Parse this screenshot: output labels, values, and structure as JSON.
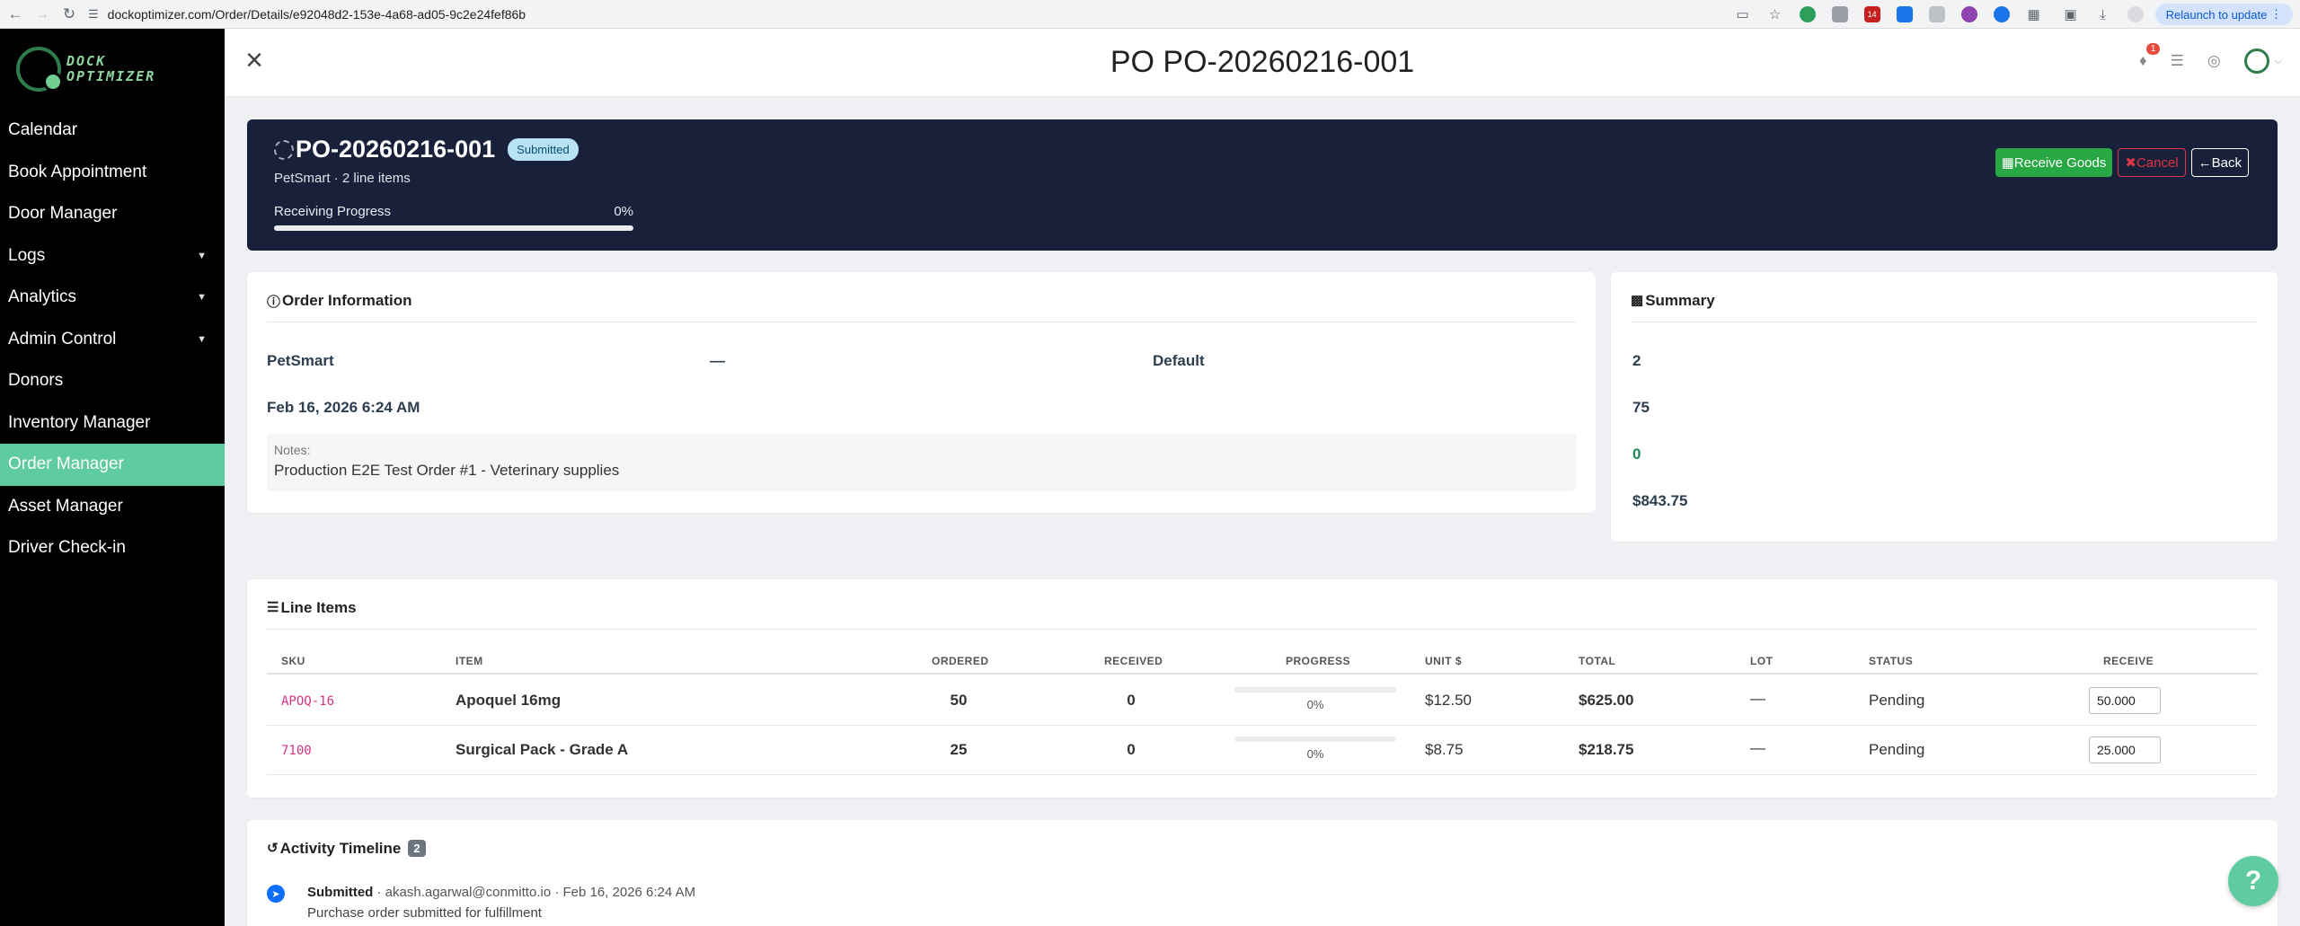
{
  "browser": {
    "url": "dockoptimizer.com/Order/Details/e92048d2-153e-4a68-ad05-9c2e24fef86b",
    "relaunch_label": "Relaunch to update",
    "ext_badge": "14"
  },
  "sidebar": {
    "logo_line1": "DOCK",
    "logo_line2": "OPTIMIZER",
    "items": [
      {
        "label": "Calendar"
      },
      {
        "label": "Book Appointment"
      },
      {
        "label": "Door Manager"
      },
      {
        "label": "Logs"
      },
      {
        "label": "Analytics"
      },
      {
        "label": "Admin Control"
      },
      {
        "label": "Donors"
      },
      {
        "label": "Inventory Manager"
      },
      {
        "label": "Order Manager"
      },
      {
        "label": "Asset Manager"
      },
      {
        "label": "Driver Check-in"
      }
    ]
  },
  "header": {
    "title": "PO PO-20260216-001",
    "notification_count": "1"
  },
  "hero": {
    "po_number": "PO-20260216-001",
    "status": "Submitted",
    "subtitle": "PetSmart · 2 line items",
    "progress_label": "Receiving Progress",
    "progress_value": "0%",
    "progress_fraction": 0,
    "receive_label": "Receive Goods",
    "cancel_label": "Cancel",
    "back_label": "Back"
  },
  "order_info": {
    "heading": "Order Information",
    "supplier": "PetSmart",
    "dash": "—",
    "default": "Default",
    "date": "Feb 16, 2026 6:24 AM",
    "notes_label": "Notes:",
    "notes": "Production E2E Test Order #1 - Veterinary supplies"
  },
  "summary": {
    "heading": "Summary",
    "values": [
      "2",
      "75",
      "0",
      "$843.75"
    ]
  },
  "line_items": {
    "heading": "Line Items",
    "columns": [
      "SKU",
      "ITEM",
      "ORDERED",
      "RECEIVED",
      "PROGRESS",
      "UNIT $",
      "TOTAL",
      "LOT",
      "STATUS",
      "RECEIVE"
    ],
    "rows": [
      {
        "sku": "APOQ-16",
        "item": "Apoquel 16mg",
        "ordered": "50",
        "received": "0",
        "progress": "0%",
        "progress_fraction": 0,
        "unit": "$12.50",
        "total": "$625.00",
        "lot": "—",
        "status": "Pending",
        "receive": "50.000"
      },
      {
        "sku": "7100",
        "item": "Surgical Pack - Grade A",
        "ordered": "25",
        "received": "0",
        "progress": "0%",
        "progress_fraction": 0,
        "unit": "$8.75",
        "total": "$218.75",
        "lot": "—",
        "status": "Pending",
        "receive": "25.000"
      }
    ]
  },
  "timeline": {
    "heading": "Activity Timeline",
    "count": "2",
    "entries": [
      {
        "status": "Submitted",
        "meta": " · akash.agarwal@conmitto.io · Feb 16, 2026 6:24 AM",
        "description": "Purchase order submitted for fulfillment"
      }
    ]
  },
  "chat": {
    "icon": "?"
  }
}
